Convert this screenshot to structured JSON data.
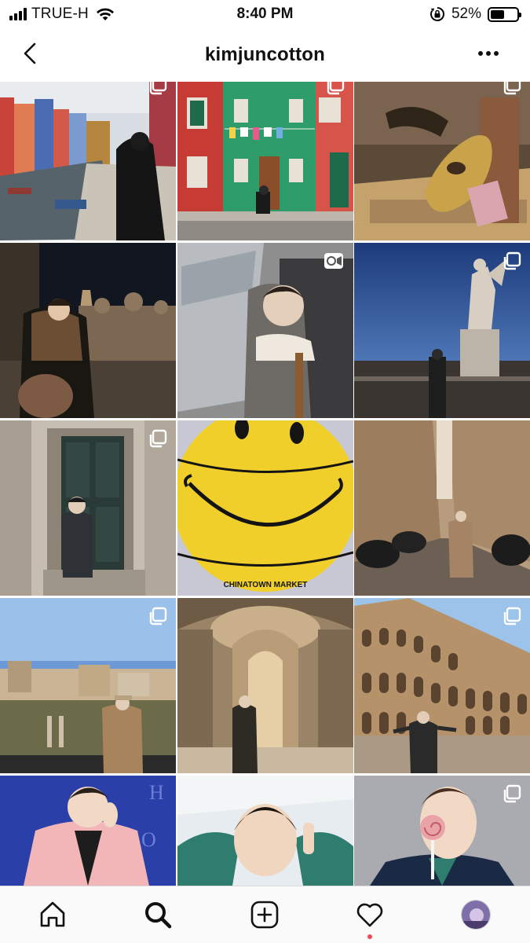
{
  "status_bar": {
    "carrier": "TRUE-H",
    "time": "8:40 PM",
    "battery_percent": "52%",
    "battery_level": 0.52,
    "icons": [
      "signal-bars-icon",
      "wifi-icon",
      "rotation-lock-icon",
      "battery-icon"
    ]
  },
  "header": {
    "title": "kimjuncotton",
    "back_icon": "chevron-left-icon",
    "more_icon": "more-horizontal-icon"
  },
  "grid": {
    "posts": [
      {
        "scene": "Venice canal with colorful houses, man in black coat",
        "badge": "carousel-icon"
      },
      {
        "scene": "Man sitting in front of green and red house with laundry line",
        "badge": "carousel-icon"
      },
      {
        "scene": "Golden Venetian carnival mask on display",
        "badge": "carousel-icon"
      },
      {
        "scene": "Man in shearling jacket at night in St. Mark's Square",
        "badge": ""
      },
      {
        "scene": "Man sleeping by train window",
        "badge": "video-icon"
      },
      {
        "scene": "Man standing by angel statue at dusk",
        "badge": "carousel-icon"
      },
      {
        "scene": "Man in front of large dark green door",
        "badge": "carousel-icon"
      },
      {
        "scene": "Yellow smiley-face basketball",
        "badge": "",
        "ball_text": "CHINATOWN MARKET"
      },
      {
        "scene": "Man walking down narrow street lined with scooters",
        "badge": ""
      },
      {
        "scene": "Man overlooking the Roman Forum",
        "badge": "carousel-icon"
      },
      {
        "scene": "Man inside St. Peter's Basilica",
        "badge": ""
      },
      {
        "scene": "Man in front of the Colosseum",
        "badge": "carousel-icon"
      },
      {
        "scene": "Man in pink suit against blue background",
        "badge": ""
      },
      {
        "scene": "Man smiling in airplane seat",
        "badge": ""
      },
      {
        "scene": "Man holding a lollipop in front of face",
        "badge": "carousel-icon"
      }
    ]
  },
  "tab_bar": {
    "tabs": [
      {
        "name": "home",
        "icon": "home-icon"
      },
      {
        "name": "search",
        "icon": "search-icon",
        "active": true
      },
      {
        "name": "new-post",
        "icon": "add-post-icon"
      },
      {
        "name": "activity",
        "icon": "heart-icon",
        "has_notification": true
      },
      {
        "name": "profile",
        "icon": "avatar"
      }
    ]
  },
  "colors": {
    "notification_dot": "#ed4956",
    "tab_bar_bg": "#fafafa",
    "text": "#111111"
  }
}
